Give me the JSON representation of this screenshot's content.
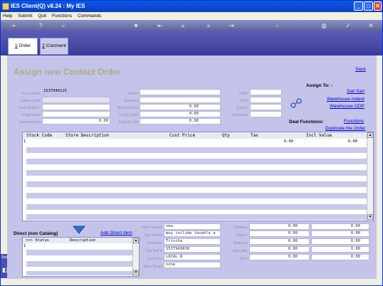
{
  "window": {
    "title": "IES Client(Q) v8.24 : My IES",
    "buttons": {
      "minimize": "_",
      "maximize": "□",
      "close": "✕"
    }
  },
  "menu": [
    "Help",
    "Submit",
    "Quit",
    "Functions",
    "Commands"
  ],
  "toolbar_icons": [
    "key-icon",
    "help-icon",
    "search-icon",
    "heart-icon",
    "first-icon",
    "prev-icon",
    "next-icon",
    "last-icon",
    "document-icon",
    "globe-icon",
    "check-icon",
    "close-icon"
  ],
  "tabs": [
    {
      "num": "1",
      "label": "Order"
    },
    {
      "num": "2",
      "label": "Comment"
    }
  ],
  "page": {
    "title": "Assign new Contact Order",
    "save_link": "Save"
  },
  "form_left": {
    "first_order_label": "First Order",
    "first_order_value": "1537946225",
    "sales_code_label": "Sales Code",
    "sales_code_value": "",
    "cust_order_label": "Cust Order #",
    "cust_order_value": "",
    "origination_label": "Origination",
    "origination_value": "",
    "deposit_label": "Deposit Amt",
    "deposit_value": "0.00"
  },
  "form_mid": {
    "name_label": "Name",
    "name_value": "",
    "account_label": "Account",
    "account_value": "",
    "account_bal_label": "Account Bal",
    "account_bal_value": "0.00",
    "credit_limit_label": "Credit Limit",
    "credit_limit_value": "0.00",
    "avail_credit_label": "Avail Credit",
    "avail_credit_value": "0.00"
  },
  "form_right": {
    "crm_label": "CRM",
    "club_label": "Club",
    "expiry_label": "Expiry",
    "directive_label": "Directive"
  },
  "assign": {
    "title": "Assign To: -",
    "links": [
      "Sari Sari",
      "Warehouse Indent",
      "Warehouse ODP"
    ]
  },
  "deal": {
    "title": "Deal Functions:",
    "links": [
      "Functions",
      "Duplicate the Order"
    ]
  },
  "grid": {
    "headers": [
      "Stock Code",
      "Store Description",
      "Cust Price",
      "Qty",
      "Tax",
      "Incl Value"
    ],
    "row_marker": "1",
    "row": {
      "tax": "0.00",
      "incl_value": "0.00"
    }
  },
  "direct": {
    "title": "Direct (non Catalog)",
    "add_link": "Add Direct Item",
    "headers": [
      ">>> Status",
      "Description"
    ],
    "row_marker": "1"
  },
  "deal_status": {
    "deal_status_label": "Deal Status",
    "deal_status_value": "new",
    "tax_status_label": "Tax Status",
    "tax_status_value": "may include taxable a",
    "operator_label": "Operator",
    "operator_value": "Trischa",
    "sys_ref_label": "Sys Ref #",
    "sys_ref_value": "1537949838",
    "currency_label": "Currency",
    "currency_value": "LOCAL R",
    "rate_basis_label": "Rate Basis",
    "rate_basis_value": "none"
  },
  "totals": {
    "rows": [
      {
        "label": "Catalog",
        "a": "0.00",
        "b": "0.00"
      },
      {
        "label": "Direct",
        "a": "0.00",
        "b": "0.00"
      },
      {
        "label": "Returns",
        "a": "0.00",
        "b": "0.00"
      },
      {
        "label": "Specials",
        "a": "0.00",
        "b": "0.00"
      },
      {
        "label": "Nett",
        "a": "0.00",
        "b": "0.00"
      }
    ]
  },
  "side_label": "Ses"
}
